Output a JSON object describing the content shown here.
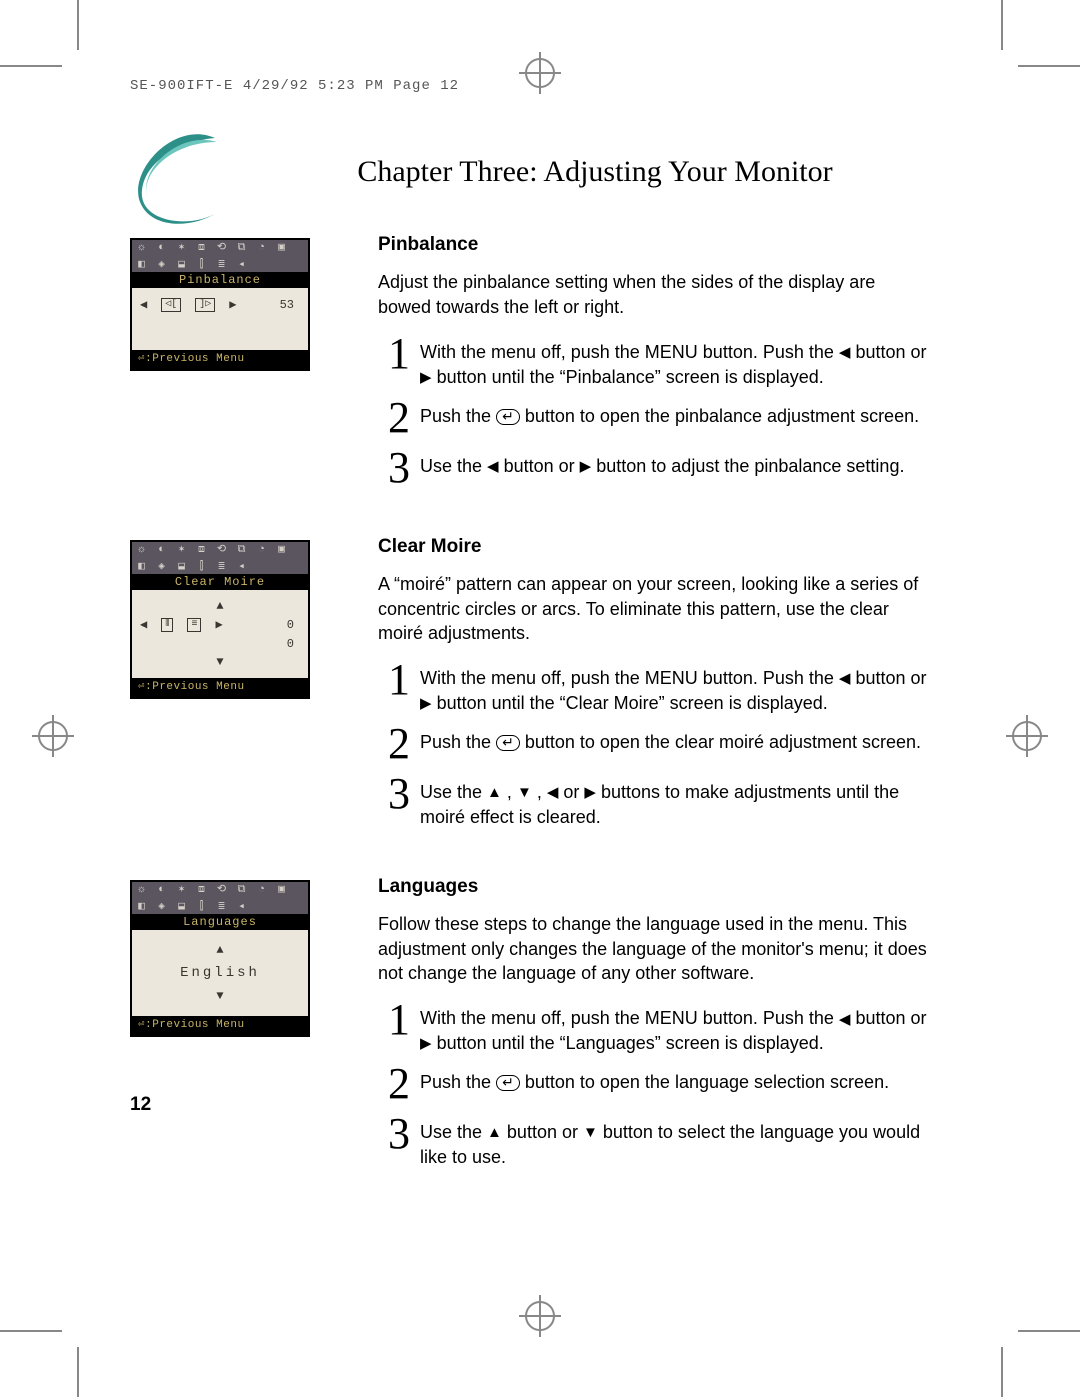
{
  "header": {
    "imprint": "SE-900IFT-E  4/29/92 5:23 PM  Page 12"
  },
  "chapter_title": "Chapter Three: Adjusting Your Monitor",
  "page_number": "12",
  "glyphs": {
    "left": "◀",
    "right": "▶",
    "up": "▲",
    "down": "▼",
    "enter": "↵"
  },
  "osd": {
    "prev_label": ":Previous Menu",
    "pinbalance": {
      "title": "Pinbalance",
      "value": "53"
    },
    "clear_moire": {
      "title": "Clear Moire",
      "value1": "0",
      "value2": "0"
    },
    "languages": {
      "title": "Languages",
      "selected": "English"
    }
  },
  "sections": {
    "pinbalance": {
      "title": "Pinbalance",
      "intro": "Adjust the pinbalance setting when the sides of the display are bowed towards the left or right.",
      "steps": [
        {
          "n": "1",
          "pre": "With the menu off, push the MENU button. Push the ",
          "g1": "◀",
          "mid": " button or ",
          "g2": "▶",
          "post": " button until the “Pinbalance” screen is displayed."
        },
        {
          "n": "2",
          "pre": "Push the ",
          "g1": "↵",
          "post": " button to open the pinbalance adjustment screen."
        },
        {
          "n": "3",
          "pre": "Use the ",
          "g1": "◀",
          "mid": " button or ",
          "g2": "▶",
          "post": " button to adjust the pinbalance setting."
        }
      ]
    },
    "clear_moire": {
      "title": "Clear Moire",
      "intro": "A “moiré” pattern can appear on your screen, looking like a series of concentric circles or arcs. To eliminate this pattern, use the clear moiré adjustments.",
      "steps": [
        {
          "n": "1",
          "pre": "With the menu off, push the MENU button. Push the ",
          "g1": "◀",
          "mid": " button or ",
          "g2": "▶",
          "post": " button until the “Clear Moire” screen is displayed."
        },
        {
          "n": "2",
          "pre": "Push the ",
          "g1": "↵",
          "post": " button to open the clear moiré adjustment screen."
        },
        {
          "n": "3",
          "pre": "Use the ",
          "g1": "▲",
          "mid1": ", ",
          "g2": "▼",
          "mid2": ", ",
          "g3": "◀",
          "mid3": " or ",
          "g4": "▶",
          "post": " buttons to make adjustments until the moiré effect is cleared."
        }
      ]
    },
    "languages": {
      "title": "Languages",
      "intro": "Follow these steps to change the language used in the menu. This adjustment only changes the language of the monitor's menu; it does not change the language of any other software.",
      "steps": [
        {
          "n": "1",
          "pre": "With the menu off, push the MENU button. Push the ",
          "g1": "◀",
          "mid": " button or ",
          "g2": "▶",
          "post": " button until the “Languages” screen is displayed."
        },
        {
          "n": "2",
          "pre": "Push the ",
          "g1": "↵",
          "post": " button to open the language selection screen."
        },
        {
          "n": "3",
          "pre": "Use the ",
          "g1": "▲",
          "mid": " button or ",
          "g2": "▼",
          "post": " button to select the language you would like to use."
        }
      ]
    }
  }
}
